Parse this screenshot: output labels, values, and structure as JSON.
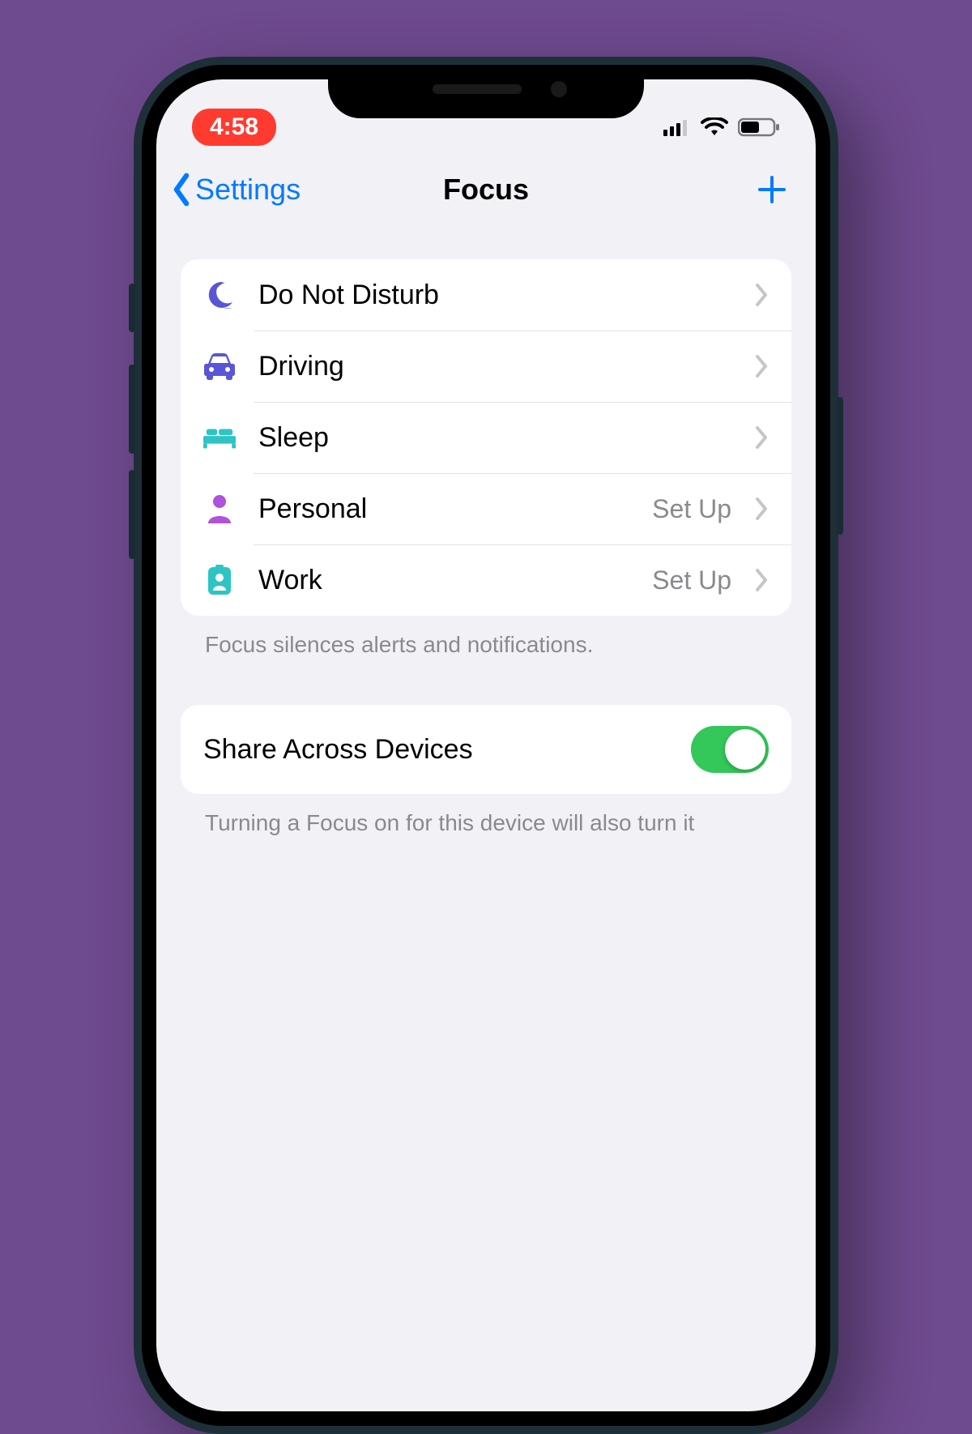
{
  "status": {
    "time": "4:58",
    "recording": true
  },
  "nav": {
    "back_label": "Settings",
    "title": "Focus"
  },
  "focus_modes": [
    {
      "icon": "moon",
      "label": "Do Not Disturb",
      "detail": "",
      "color": "#5856d6"
    },
    {
      "icon": "car",
      "label": "Driving",
      "detail": "",
      "color": "#5856d6"
    },
    {
      "icon": "bed",
      "label": "Sleep",
      "detail": "",
      "color": "#2ec4c4"
    },
    {
      "icon": "person",
      "label": "Personal",
      "detail": "Set Up",
      "color": "#af52de"
    },
    {
      "icon": "badge",
      "label": "Work",
      "detail": "Set Up",
      "color": "#2ec4c4"
    }
  ],
  "footer1": "Focus silences alerts and notifications.",
  "share": {
    "label": "Share Across Devices",
    "enabled": true
  },
  "footer2": "Turning a Focus on for this device will also turn it"
}
